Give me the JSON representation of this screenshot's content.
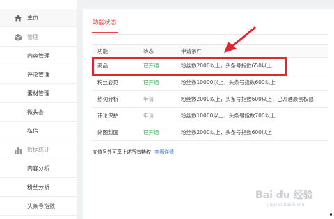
{
  "sidebar": {
    "items": [
      {
        "label": "主页",
        "icon": "home-icon",
        "type": "top"
      },
      {
        "label": "管理",
        "icon": "cube-icon",
        "type": "group"
      },
      {
        "label": "内容管理",
        "type": "sub"
      },
      {
        "label": "评论管理",
        "type": "sub"
      },
      {
        "label": "素材管理",
        "type": "sub"
      },
      {
        "label": "微头条",
        "type": "sub"
      },
      {
        "label": "私信",
        "type": "sub"
      },
      {
        "label": "数据统计",
        "icon": "bar-chart-icon",
        "type": "group"
      },
      {
        "label": "内容分析",
        "type": "sub"
      },
      {
        "label": "粉丝分析",
        "type": "sub"
      },
      {
        "label": "头条号指数",
        "type": "sub"
      }
    ]
  },
  "main": {
    "tab_label": "功能状态",
    "table": {
      "headers": [
        "功能",
        "状态",
        "申请条件"
      ],
      "rows": [
        {
          "feature": "商品",
          "status": "已开通",
          "status_type": "open",
          "condition": "粉丝数2000以上，头条号指数650以上"
        },
        {
          "feature": "粉丝必见",
          "status": "已开通",
          "status_type": "open",
          "condition": "粉丝数10000以上，头条号指数600以上"
        },
        {
          "feature": "热词分析",
          "status": "申请",
          "status_type": "apply",
          "condition": "粉丝数2000以上，头条号指数600以上，已开通原创权限"
        },
        {
          "feature": "评论保护",
          "status": "申请",
          "status_type": "apply",
          "condition": "粉丝数10000以上，头条号指数700以上"
        },
        {
          "feature": "外图封面",
          "status": "已开通",
          "status_type": "open",
          "condition": "粉丝数2000以上，头条号指数600以上"
        }
      ]
    },
    "footer_text": "充值号外可享上述所有特权",
    "footer_link": "查看详情"
  },
  "watermark": {
    "text": "Bai du 经验",
    "sub": "jingyan.baidu.com"
  },
  "colors": {
    "accent": "#e5463a",
    "open": "#2fa84f",
    "apply": "#999999",
    "highlight": "#e1242f",
    "link": "#3a79d8"
  }
}
